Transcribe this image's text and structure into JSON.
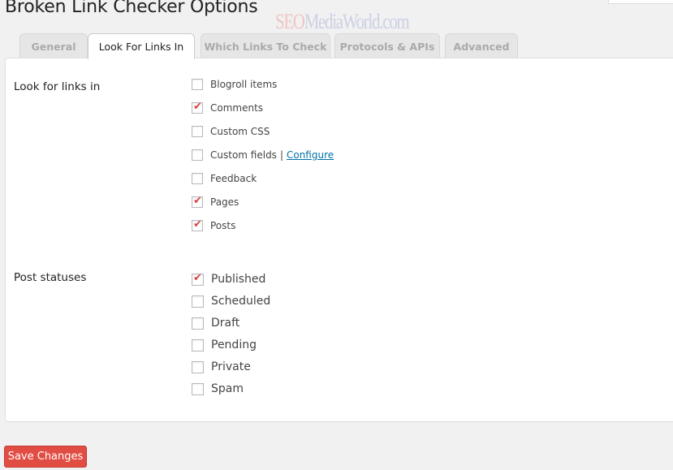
{
  "page": {
    "title": "Broken Link Checker Options",
    "watermark": {
      "part1": "SEO",
      "part2": "MediaWorld.com"
    }
  },
  "tabs": [
    {
      "label": "General",
      "active": false
    },
    {
      "label": "Look For Links In",
      "active": true
    },
    {
      "label": "Which Links To Check",
      "active": false
    },
    {
      "label": "Protocols & APIs",
      "active": false
    },
    {
      "label": "Advanced",
      "active": false
    }
  ],
  "look_for_links": {
    "label": "Look for links in",
    "options": [
      {
        "label": "Blogroll items",
        "checked": false
      },
      {
        "label": "Comments",
        "checked": true
      },
      {
        "label": "Custom CSS",
        "checked": false
      },
      {
        "label": "Custom fields",
        "checked": false,
        "separator": "|",
        "link": "Configure"
      },
      {
        "label": "Feedback",
        "checked": false
      },
      {
        "label": "Pages",
        "checked": true
      },
      {
        "label": "Posts",
        "checked": true
      }
    ]
  },
  "post_statuses": {
    "label": "Post statuses",
    "options": [
      {
        "label": "Published",
        "checked": true
      },
      {
        "label": "Scheduled",
        "checked": false
      },
      {
        "label": "Draft",
        "checked": false
      },
      {
        "label": "Pending",
        "checked": false
      },
      {
        "label": "Private",
        "checked": false
      },
      {
        "label": "Spam",
        "checked": false
      }
    ]
  },
  "check_glyph": "✔",
  "actions": {
    "save_label": "Save Changes"
  },
  "colors": {
    "accent": "#e14d43",
    "check": "#d94141",
    "link": "#0073aa"
  }
}
